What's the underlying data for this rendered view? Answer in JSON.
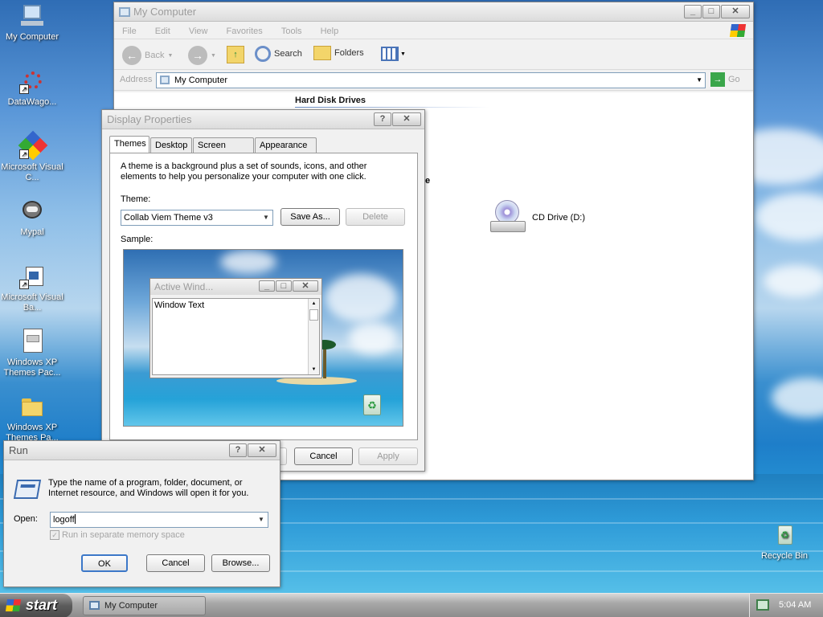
{
  "desktop": {
    "icons": [
      {
        "label": "My Computer"
      },
      {
        "label": "DataWago..."
      },
      {
        "label": "Microsoft Visual C..."
      },
      {
        "label": "Mypal"
      },
      {
        "label": "Microsoft Visual Ba..."
      },
      {
        "label": "Windows XP Themes Pac..."
      },
      {
        "label": "Windows XP Themes Pa..."
      },
      {
        "label": "Recycle Bin"
      }
    ]
  },
  "my_computer": {
    "title": "My Computer",
    "menu": [
      "File",
      "Edit",
      "View",
      "Favorites",
      "Tools",
      "Help"
    ],
    "toolbar": {
      "back": "Back",
      "search": "Search",
      "folders": "Folders"
    },
    "address": {
      "label": "Address",
      "value": "My Computer",
      "go": "Go"
    },
    "section_header": "Hard Disk Drives",
    "partial_text": "e",
    "cd_drive": "CD Drive (D:)"
  },
  "display_properties": {
    "title": "Display Properties",
    "tabs": [
      "Themes",
      "Desktop",
      "Screen Saver",
      "Appearance"
    ],
    "description": "A theme is a background plus a set of sounds, icons, and other elements to help you personalize your computer with one click.",
    "theme_label": "Theme:",
    "theme_value": "Collab Viem Theme v3",
    "save_as": "Save As...",
    "delete": "Delete",
    "sample_label": "Sample:",
    "sample_window_title": "Active Wind...",
    "sample_window_text": "Window Text",
    "cancel": "Cancel",
    "apply": "Apply"
  },
  "run": {
    "title": "Run",
    "description": "Type the name of a program, folder, document, or Internet resource, and Windows will open it for you.",
    "open_label": "Open:",
    "open_value": "logoff",
    "checkbox_label": "Run in separate memory space",
    "ok": "OK",
    "cancel": "Cancel",
    "browse": "Browse..."
  },
  "taskbar": {
    "start": "start",
    "tasks": [
      "My Computer"
    ],
    "clock": "5:04 AM"
  },
  "colors": {
    "accent": "#2f6db5",
    "window_bg": "#f1f1f1"
  }
}
